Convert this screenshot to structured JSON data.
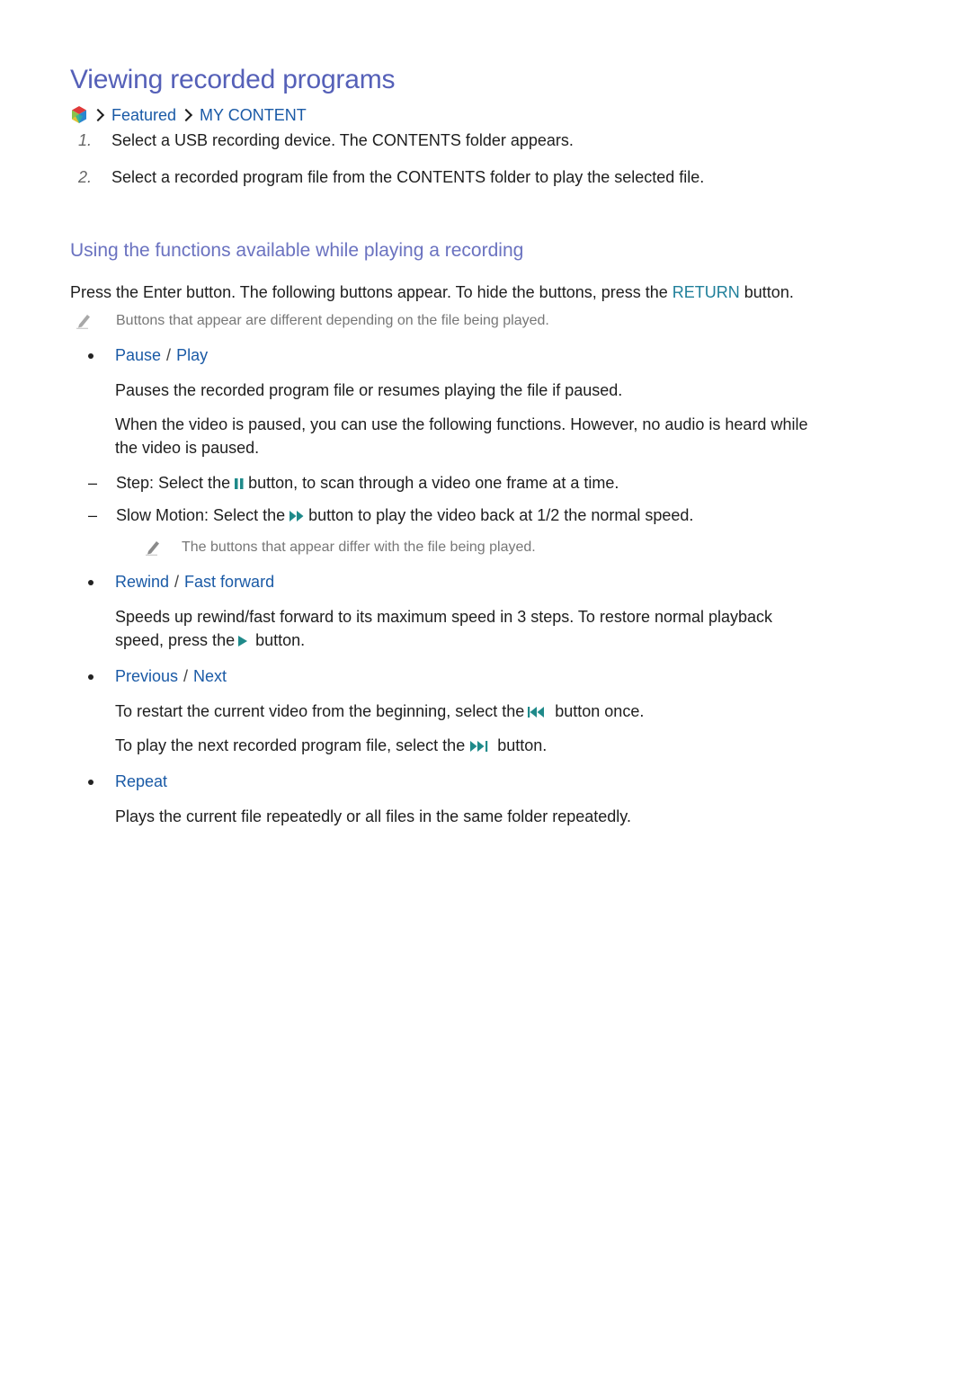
{
  "title": "Viewing recorded programs",
  "breadcrumb": {
    "home_icon": "smart-hub-icon",
    "items": [
      "Featured",
      "MY CONTENT"
    ]
  },
  "steps": [
    {
      "num": "1.",
      "text": "Select a USB recording device. The CONTENTS folder appears."
    },
    {
      "num": "2.",
      "text": "Select a recorded program file from the CONTENTS folder to play the selected file."
    }
  ],
  "section": {
    "title": "Using the functions available while playing a recording",
    "intro_before": "Press the Enter button. The following buttons appear. To hide the buttons, press the ",
    "intro_key": "RETURN",
    "intro_after": " button.",
    "note": "Buttons that appear are different depending on the file being played."
  },
  "items": {
    "pause_play": {
      "label_a": "Pause",
      "label_b": "Play",
      "desc1": "Pauses the recorded program file or resumes playing the file if paused.",
      "desc2_line1": "When the video is paused, you can use the following functions. However, no audio is heard while",
      "desc2_line2": "the video is paused.",
      "sub": [
        {
          "dash": "–",
          "term": "Step",
          "before": ": Select the ",
          "icon": "pause-icon",
          "after": " button, to scan through a video one frame at a time."
        },
        {
          "dash": "–",
          "term": "Slow Motion",
          "before": ": Select the ",
          "icon": "fast-forward-icon",
          "after": " button to play the video back at 1/2 the normal speed."
        }
      ],
      "sub_note": "The buttons that appear differ with the file being played."
    },
    "rewind_ff": {
      "label_a": "Rewind",
      "label_b": "Fast forward",
      "desc_line1": "Speeds up rewind/fast forward to its maximum speed in 3 steps. To restore normal playback",
      "desc_line2_before": "speed, press the ",
      "desc_line2_icon": "play-icon",
      "desc_line2_after": " button."
    },
    "prev_next": {
      "label_a": "Previous",
      "label_b": "Next",
      "desc1_before": "To restart the current video from the beginning, select the ",
      "desc1_icon": "skip-previous-icon",
      "desc1_after": " button once.",
      "desc2_before": "To play the next recorded program file, select the ",
      "desc2_icon": "skip-next-icon",
      "desc2_after": " button."
    },
    "repeat": {
      "label": "Repeat",
      "desc": "Plays the current file repeatedly or all files in the same folder repeatedly."
    }
  },
  "separator": "/",
  "colors": {
    "title": "#5560b8",
    "subtitle": "#6a72c0",
    "link": "#1a5aa6",
    "key": "#1f7f9a",
    "icon_teal": "#1f8a8a"
  }
}
